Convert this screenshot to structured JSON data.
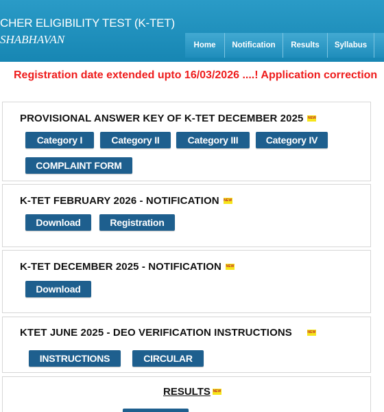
{
  "header": {
    "title": "CHER ELIGIBILITY TEST (K-TET)",
    "subtitle": "SHABHAVAN"
  },
  "nav": {
    "items": [
      "Home",
      "Notification",
      "Results",
      "Syllabus",
      ""
    ]
  },
  "marquee": "Registration date extended upto 16/03/2026 ....! Application correction",
  "badges": {
    "new": "NEW"
  },
  "sections": {
    "answer_key": {
      "title": "PROVISIONAL ANSWER KEY OF K-TET DECEMBER 2025",
      "buttons": [
        "Category I",
        "Category II",
        "Category III",
        "Category IV",
        "COMPLAINT FORM"
      ]
    },
    "feb_2026": {
      "title": "K-TET FEBRUARY 2026 - NOTIFICATION",
      "buttons": [
        "Download",
        "Registration"
      ]
    },
    "dec_2025": {
      "title": "K-TET DECEMBER 2025 - NOTIFICATION",
      "buttons": [
        "Download"
      ]
    },
    "deo": {
      "title": "KTET JUNE 2025 - DEO VERIFICATION INSTRUCTIONS",
      "buttons": [
        "INSTRUCTIONS",
        "CIRCULAR"
      ]
    },
    "results": {
      "title": "RESULTS"
    }
  },
  "colors": {
    "header": "#1786b3",
    "button": "#1e5f8e",
    "marquee": "#ee1c1c",
    "badge": "#f6e51a"
  }
}
